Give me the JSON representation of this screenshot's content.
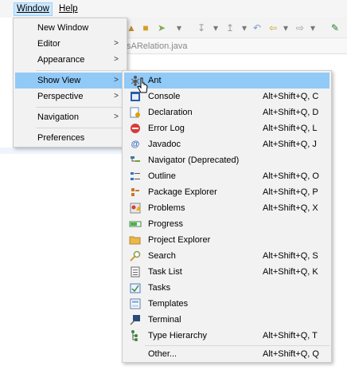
{
  "menubar": {
    "window_label": "Window",
    "help_label": "Help"
  },
  "editor": {
    "tab_title": "sARelation.java"
  },
  "window_menu": {
    "items": [
      {
        "label": "New Window",
        "submenu": false
      },
      {
        "label": "Editor",
        "submenu": true
      },
      {
        "label": "Appearance",
        "submenu": true
      },
      {
        "label": "Show View",
        "submenu": true,
        "selected": true
      },
      {
        "label": "Perspective",
        "submenu": true
      },
      {
        "label": "Navigation",
        "submenu": true
      },
      {
        "label": "Preferences",
        "submenu": false
      }
    ]
  },
  "show_view_menu": {
    "items": [
      {
        "label": "Ant",
        "shortcut": "",
        "icon": "ant-icon",
        "selected": true
      },
      {
        "label": "Console",
        "shortcut": "Alt+Shift+Q, C",
        "icon": "console-icon"
      },
      {
        "label": "Declaration",
        "shortcut": "Alt+Shift+Q, D",
        "icon": "declaration-icon"
      },
      {
        "label": "Error Log",
        "shortcut": "Alt+Shift+Q, L",
        "icon": "error-log-icon"
      },
      {
        "label": "Javadoc",
        "shortcut": "Alt+Shift+Q, J",
        "icon": "javadoc-icon",
        "icon_glyph": "@"
      },
      {
        "label": "Navigator (Deprecated)",
        "shortcut": "",
        "icon": "navigator-icon"
      },
      {
        "label": "Outline",
        "shortcut": "Alt+Shift+Q, O",
        "icon": "outline-icon"
      },
      {
        "label": "Package Explorer",
        "shortcut": "Alt+Shift+Q, P",
        "icon": "package-explorer-icon"
      },
      {
        "label": "Problems",
        "shortcut": "Alt+Shift+Q, X",
        "icon": "problems-icon"
      },
      {
        "label": "Progress",
        "shortcut": "",
        "icon": "progress-icon"
      },
      {
        "label": "Project Explorer",
        "shortcut": "",
        "icon": "project-explorer-icon"
      },
      {
        "label": "Search",
        "shortcut": "Alt+Shift+Q, S",
        "icon": "search-icon"
      },
      {
        "label": "Task List",
        "shortcut": "Alt+Shift+Q, K",
        "icon": "task-list-icon"
      },
      {
        "label": "Tasks",
        "shortcut": "",
        "icon": "tasks-icon"
      },
      {
        "label": "Templates",
        "shortcut": "",
        "icon": "templates-icon"
      },
      {
        "label": "Terminal",
        "shortcut": "",
        "icon": "terminal-icon"
      },
      {
        "label": "Type Hierarchy",
        "shortcut": "Alt+Shift+Q, T",
        "icon": "type-hierarchy-icon"
      },
      {
        "label": "Other...",
        "shortcut": "Alt+Shift+Q, Q",
        "icon": ""
      }
    ]
  },
  "colors": {
    "selection": "#91c9f7",
    "menu_bg": "#f2f2f2",
    "menubar_active": "#cce8ff"
  }
}
